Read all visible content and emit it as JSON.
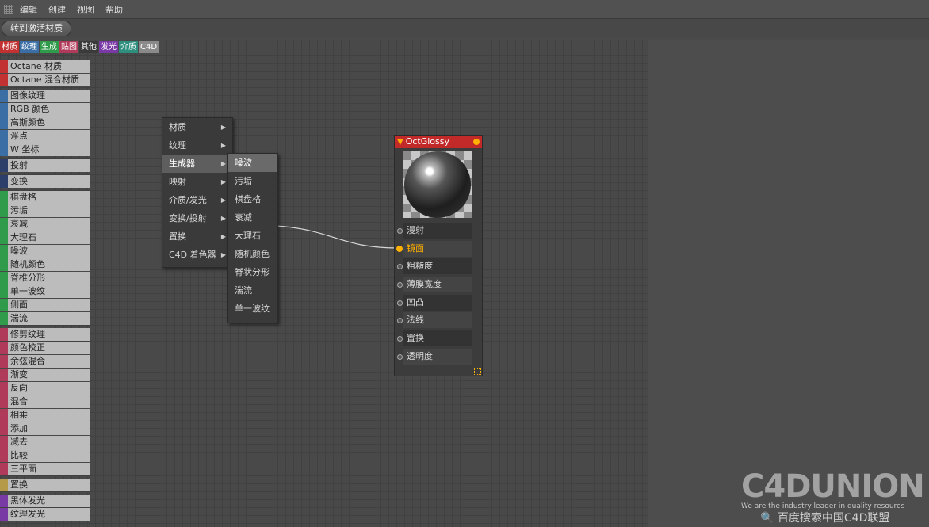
{
  "menubar": {
    "items": [
      "编辑",
      "创建",
      "视图",
      "帮助"
    ]
  },
  "toolbar": {
    "convert_button": "转到激活材质"
  },
  "tabs": [
    {
      "label": "材质",
      "color": "#c23232"
    },
    {
      "label": "纹理",
      "color": "#3a6ea5"
    },
    {
      "label": "生成",
      "color": "#2f9b4b"
    },
    {
      "label": "贴图",
      "color": "#b03a5a"
    },
    {
      "label": "其他",
      "color": "#3a3a3a"
    },
    {
      "label": "发光",
      "color": "#7a3aa5"
    },
    {
      "label": "介质",
      "color": "#2f8f7f"
    },
    {
      "label": "C4D",
      "color": "#8a8a8a"
    }
  ],
  "sidebar": {
    "groups": [
      {
        "color": "#c23232",
        "items": [
          "Octane 材质",
          "Octane 混合材质"
        ]
      },
      {
        "color": "#3a6ea5",
        "items": [
          "图像纹理",
          "RGB 颜色",
          "高斯颜色",
          "浮点",
          "W 坐标"
        ]
      },
      {
        "color": "#2c3e6a",
        "items": [
          "投射"
        ]
      },
      {
        "color": "#2c3e6a",
        "items": [
          "变换"
        ]
      },
      {
        "color": "#2f9b4b",
        "items": [
          "棋盘格",
          "污垢",
          "衰减",
          "大理石",
          "噪波",
          "随机颜色",
          "脊椎分形",
          "单一波纹",
          "侧面",
          "湍流"
        ]
      },
      {
        "color": "#b03a5a",
        "items": [
          "修剪纹理",
          "颜色校正",
          "余弦混合",
          "渐变",
          "反向",
          "混合",
          "相乘",
          "添加",
          "减去",
          "比较",
          "三平面"
        ]
      },
      {
        "color": "#b59a4a",
        "items": [
          "置换"
        ]
      },
      {
        "color": "#7a3aa5",
        "items": [
          "黑体发光",
          "纹理发光"
        ]
      }
    ]
  },
  "context_menu": {
    "items": [
      {
        "label": "材质",
        "arrow": "▶"
      },
      {
        "label": "纹理",
        "arrow": "▶"
      },
      {
        "label": "生成器",
        "arrow": "▶"
      },
      {
        "label": "映射",
        "arrow": "▶"
      },
      {
        "label": "介质/发光",
        "arrow": "▶"
      },
      {
        "label": "变换/投射",
        "arrow": "▶"
      },
      {
        "label": "置换",
        "arrow": "▶"
      },
      {
        "label": "C4D 着色器",
        "arrow": "▶"
      }
    ],
    "active_index": 2
  },
  "submenu": {
    "items": [
      "噪波",
      "污垢",
      "棋盘格",
      "衰减",
      "大理石",
      "随机颜色",
      "脊状分形",
      "湍流",
      "单一波纹"
    ],
    "highlight_index": 0
  },
  "node": {
    "title": "OctGlossy",
    "header_color": "#c22a2a",
    "ports": [
      {
        "label": "漫射",
        "connected": false
      },
      {
        "label": "镜面",
        "connected": true
      },
      {
        "label": "粗糙度",
        "connected": false
      },
      {
        "label": "薄膜宽度",
        "connected": false
      },
      {
        "label": "凹凸",
        "connected": false
      },
      {
        "label": "法线",
        "connected": false
      },
      {
        "label": "置换",
        "connected": false
      },
      {
        "label": "透明度",
        "connected": false
      }
    ]
  },
  "watermark": {
    "logo": "C4DUNION",
    "tagline": "We are the industry leader in quality resoures",
    "search_text": "百度搜索中国C4D联盟"
  }
}
